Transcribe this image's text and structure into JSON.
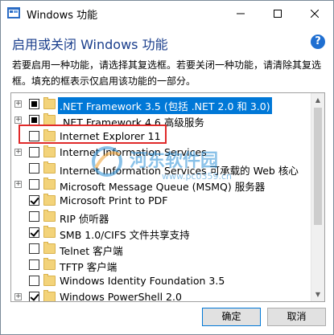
{
  "window": {
    "title": "Windows 功能",
    "heading": "启用或关闭 Windows 功能",
    "description": "若要启用一种功能，请选择其复选框。若要关闭一种功能，请清除其复选框。填充的框表示仅启用该功能的一部分。"
  },
  "features": [
    {
      "label": ".NET Framework 3.5 (包括 .NET 2.0 和 3.0)",
      "expandable": true,
      "state": "partial",
      "selected": true
    },
    {
      "label": ".NET Framework 4.6 高级服务",
      "expandable": true,
      "state": "partial",
      "selected": false
    },
    {
      "label": "Internet Explorer 11",
      "expandable": false,
      "state": "unchecked",
      "selected": false
    },
    {
      "label": "Internet Information Services",
      "expandable": true,
      "state": "unchecked",
      "selected": false
    },
    {
      "label": "Internet Information Services 可承载的 Web 核心",
      "expandable": false,
      "state": "unchecked",
      "selected": false
    },
    {
      "label": "Microsoft Message Queue (MSMQ) 服务器",
      "expandable": true,
      "state": "unchecked",
      "selected": false
    },
    {
      "label": "Microsoft Print to PDF",
      "expandable": false,
      "state": "checked",
      "selected": false
    },
    {
      "label": "RIP 侦听器",
      "expandable": false,
      "state": "unchecked",
      "selected": false
    },
    {
      "label": "SMB 1.0/CIFS 文件共享支持",
      "expandable": false,
      "state": "checked",
      "selected": false
    },
    {
      "label": "Telnet 客户端",
      "expandable": false,
      "state": "unchecked",
      "selected": false
    },
    {
      "label": "TFTP 客户端",
      "expandable": false,
      "state": "unchecked",
      "selected": false
    },
    {
      "label": "Windows Identity Foundation 3.5",
      "expandable": false,
      "state": "unchecked",
      "selected": false
    },
    {
      "label": "Windows PowerShell 2.0",
      "expandable": true,
      "state": "checked",
      "selected": false
    }
  ],
  "buttons": {
    "ok": "确定",
    "cancel": "取消"
  },
  "watermark": {
    "text": "河东软件园",
    "url": "www.pc0359.cn"
  },
  "colors": {
    "accent": "#0078d7",
    "heading": "#1a3e8c",
    "highlight": "#e02a2a",
    "folder": "#f3d37a"
  }
}
